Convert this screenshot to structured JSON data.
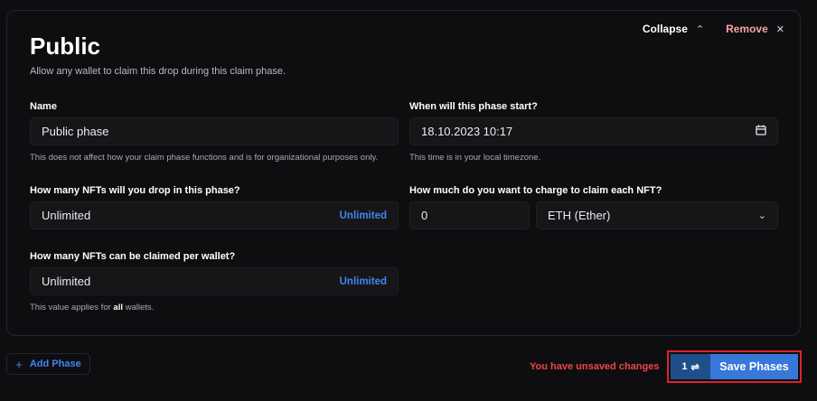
{
  "phase": {
    "title": "Public",
    "subtitle": "Allow any wallet to claim this drop during this claim phase.",
    "collapse_label": "Collapse",
    "remove_label": "Remove"
  },
  "fields": {
    "name": {
      "label": "Name",
      "value": "Public phase",
      "help": "This does not affect how your claim phase functions and is for organizational purposes only."
    },
    "start": {
      "label": "When will this phase start?",
      "value": "18.10.2023 10:17",
      "help": "This time is in your local timezone."
    },
    "drop_amount": {
      "label": "How many NFTs will you drop in this phase?",
      "value": "Unlimited",
      "toggle": "Unlimited"
    },
    "price": {
      "label": "How much do you want to charge to claim each NFT?",
      "value": "0",
      "currency": "ETH (Ether)"
    },
    "per_wallet": {
      "label": "How many NFTs can be claimed per wallet?",
      "value": "Unlimited",
      "toggle": "Unlimited",
      "help_prefix": "This value applies for ",
      "help_bold": "all",
      "help_suffix": " wallets."
    }
  },
  "footer": {
    "add_phase_label": "Add Phase",
    "unsaved_text": "You have unsaved changes",
    "change_count": "1",
    "save_label": "Save Phases"
  },
  "icons": {
    "collapse": "chevron-up-icon",
    "remove": "close-icon",
    "calendar": "calendar-icon",
    "select": "chevron-down-icon",
    "add": "plus-icon",
    "changes": "arrows-swap-icon"
  },
  "colors": {
    "accent": "#3f86f0",
    "save_button": "#3878d8",
    "warning": "#f04444",
    "remove": "#f6a3a3"
  }
}
